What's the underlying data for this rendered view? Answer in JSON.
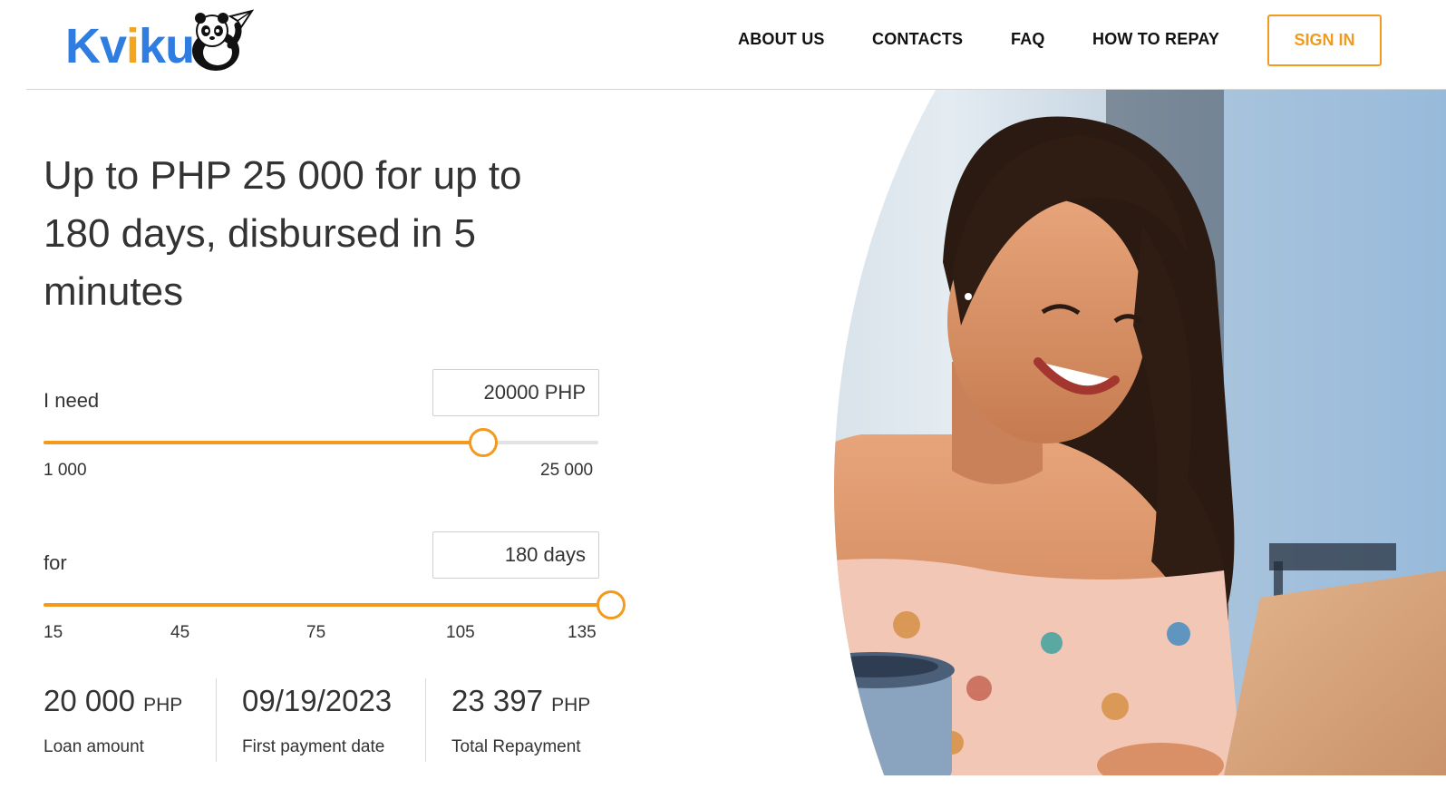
{
  "header": {
    "logo_text": "Kviku",
    "nav": [
      "ABOUT US",
      "CONTACTS",
      "FAQ",
      "HOW TO REPAY"
    ],
    "sign_in": "SIGN IN"
  },
  "hero": {
    "headline": "Up to PHP 25 000 for up to 180 days, disbursed in 5 minutes"
  },
  "amount": {
    "label": "I need",
    "value": "20000 PHP",
    "min_label": "1 000",
    "max_label": "25 000",
    "min": 1000,
    "max": 25000,
    "current": 20000
  },
  "term": {
    "label": "for",
    "value": "180 days",
    "ticks": [
      "15",
      "45",
      "75",
      "105",
      "135"
    ],
    "level": 1.0
  },
  "summary": {
    "loan_amount_value": "20 000",
    "loan_amount_unit": "PHP",
    "loan_amount_label": "Loan amount",
    "first_payment_value": "09/19/2023",
    "first_payment_label": "First payment date",
    "total_value": "23 397",
    "total_unit": "PHP",
    "total_label": "Total Repayment"
  },
  "colors": {
    "accent": "#f39a1d",
    "logo_blue": "#2f7de0",
    "logo_yellow": "#f3a51c"
  }
}
